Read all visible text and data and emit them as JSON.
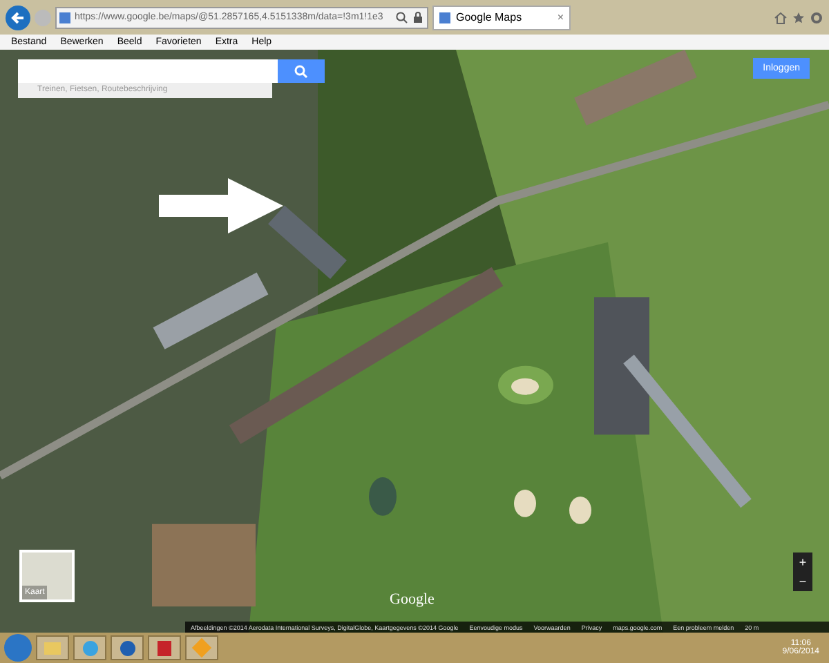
{
  "browser": {
    "url": "https://www.google.be/maps/@51.2857165,4.5151338m/data=!3m1!1e3",
    "tab": {
      "title": "Google Maps",
      "selected": true,
      "close": "×"
    },
    "menu": [
      "Bestand",
      "Bewerken",
      "Beeld",
      "Favorieten",
      "Extra",
      "Help"
    ]
  },
  "maps": {
    "search": {
      "placeholder": "Treinen, Fietsen, Routebeschrijving"
    },
    "login": "Inloggen",
    "layer_toggle": "Kaart",
    "logo": "Google",
    "attribution": [
      "Afbeeldingen ©2014 Aerodata International Surveys, DigitalGlobe, Kaartgegevens ©2014 Google",
      "Eenvoudige modus",
      "Voorwaarden",
      "Privacy",
      "maps.google.com",
      "Een probleem melden",
      "20 m"
    ],
    "zoom": [
      "+",
      "−"
    ]
  },
  "taskbar": {
    "time": "11:06",
    "date": "9/06/2014"
  }
}
